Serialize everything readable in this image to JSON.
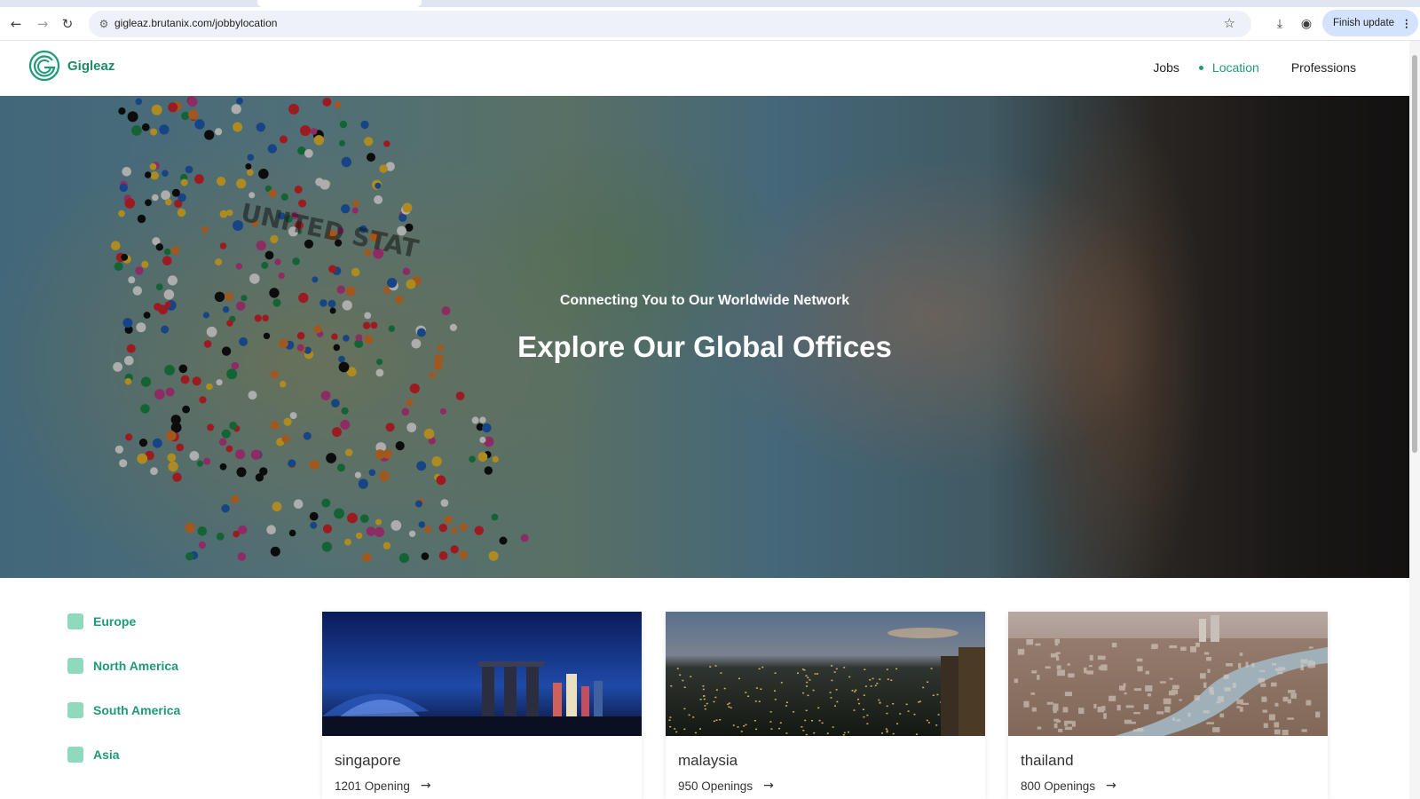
{
  "browser": {
    "url": "gigleaz.brutanix.com/jobbylocation",
    "finish_update_label": "Finish update",
    "menu_dots": "⋮"
  },
  "site": {
    "brand": "Gigleaz",
    "nav": {
      "jobs": "Jobs",
      "location": "Location",
      "professions": "Professions"
    }
  },
  "hero": {
    "subtitle": "Connecting You to Our Worldwide Network",
    "title": "Explore Our Global Offices",
    "map_label": "UNITED STAT"
  },
  "regions": [
    {
      "label": "Europe"
    },
    {
      "label": "North America"
    },
    {
      "label": "South America"
    },
    {
      "label": "Asia"
    }
  ],
  "cards": [
    {
      "name": "singapore",
      "openings": "1201 Opening"
    },
    {
      "name": "malaysia",
      "openings": "950 Openings"
    },
    {
      "name": "thailand",
      "openings": "800 Openings"
    }
  ],
  "colors": {
    "brand": "#1e9a78",
    "checkbox": "#8fd9bd",
    "update_chip": "#d3e3fd"
  }
}
